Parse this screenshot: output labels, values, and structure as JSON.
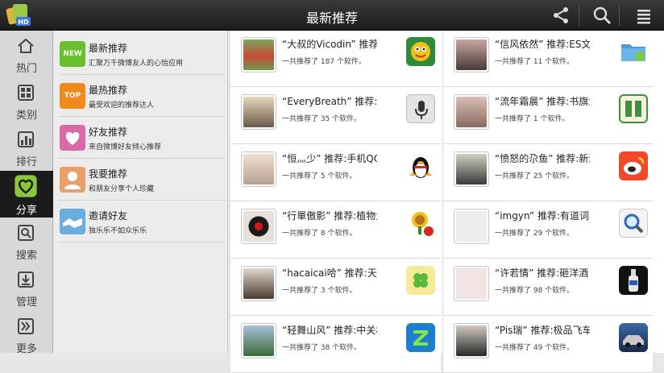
{
  "header": {
    "title": "最新推荐"
  },
  "nav": [
    {
      "label": "热门",
      "icon": "home-icon"
    },
    {
      "label": "类别",
      "icon": "grid-icon"
    },
    {
      "label": "排行",
      "icon": "ranking-icon"
    },
    {
      "label": "分享",
      "icon": "heart-icon",
      "active": true
    },
    {
      "label": "搜索",
      "icon": "search-icon"
    },
    {
      "label": "管理",
      "icon": "download-icon"
    },
    {
      "label": "更多",
      "icon": "more-icon"
    }
  ],
  "submenu": [
    {
      "title": "最新推荐",
      "desc": "汇聚万千微博友人的心怡应用",
      "badge": "NEW",
      "color": "#6abf2e"
    },
    {
      "title": "最热推荐",
      "desc": "最受欢迎的推荐达人",
      "badge": "TOP",
      "color": "#f08a1c"
    },
    {
      "title": "好友推荐",
      "desc": "来自微博好友倾心推荐",
      "badge": "",
      "color": "#d86aa8"
    },
    {
      "title": "我要推荐",
      "desc": "和朋友分享个人珍藏",
      "badge": "",
      "color": "#e8a06a"
    },
    {
      "title": "邀请好友",
      "desc": "独乐乐不如众乐乐",
      "badge": "",
      "color": "#6aaee0"
    }
  ],
  "cards": [
    {
      "title": "“大叔的Vicodin” 推荐:蛇",
      "count": "一共推荐了 187 个软件。",
      "icon": "snake-game-icon",
      "color": "#f2c21a"
    },
    {
      "title": "“信风依然” 推荐:ES文件",
      "count": "一共推荐了 11 个软件。",
      "icon": "folder-icon",
      "color": "#4a9ad8"
    },
    {
      "title": "“EveryBreath” 推荐:语音",
      "count": "一共推荐了 35 个软件。",
      "icon": "microphone-icon",
      "color": "#d0d0d0"
    },
    {
      "title": "“流年霜晨” 推荐:书旗免费",
      "count": "一共推荐了 1 个软件。",
      "icon": "book-icon",
      "color": "#3e8f3e"
    },
    {
      "title": "“恒灬少” 推荐:手机QQ",
      "count": "一共推荐了 5 个软件。",
      "icon": "qq-penguin-icon",
      "color": "#ffffff"
    },
    {
      "title": "“愤怒的尕鱼” 推荐:新浪微博",
      "count": "一共推荐了 25 个软件。",
      "icon": "weibo-icon",
      "color": "#e8372a"
    },
    {
      "title": "“行單傲影” 推荐:植物大战",
      "count": "一共推荐了 8 个软件。",
      "icon": "sunflower-icon",
      "color": "#ffffff"
    },
    {
      "title": "“imgyn” 推荐:有道词典",
      "count": "一共推荐了 29 个软件。",
      "icon": "dictionary-icon",
      "color": "#ffffff"
    },
    {
      "title": "“hacaicai哈” 推荐:天天",
      "count": "一共推荐了 3 个软件。",
      "icon": "clover-icon",
      "color": "#f0e27a"
    },
    {
      "title": "“许若情” 推荐:砸洋酒！",
      "count": "一共推荐了 98 个软件。",
      "icon": "bottle-icon",
      "color": "#1a1a1a"
    },
    {
      "title": "“轻舞山风” 推荐:中关村",
      "count": "一共推荐了 38 个软件。",
      "icon": "z-app-icon",
      "color": "#1e7ed0"
    },
    {
      "title": "“Pis瑞” 推荐:极品飞车",
      "count": "一共推荐了 49 个软件。",
      "icon": "racing-game-icon",
      "color": "#2a4f80"
    }
  ]
}
